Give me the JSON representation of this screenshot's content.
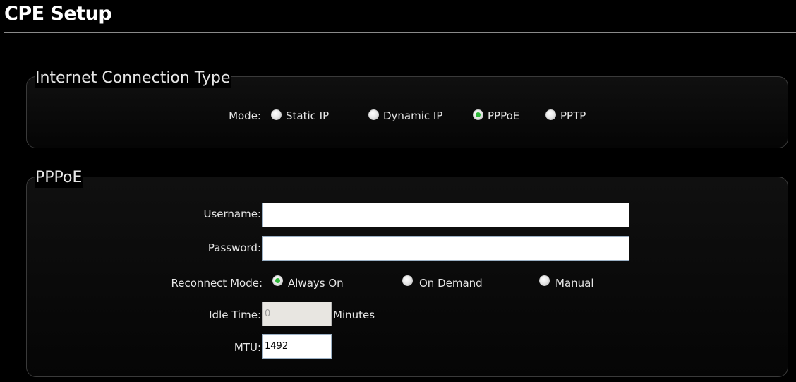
{
  "page": {
    "title": "CPE Setup"
  },
  "connection_type": {
    "legend": "Internet Connection Type",
    "mode_label": "Mode:",
    "options": [
      {
        "label": "Static IP",
        "checked": false
      },
      {
        "label": "Dynamic IP",
        "checked": false
      },
      {
        "label": "PPPoE",
        "checked": true
      },
      {
        "label": "PPTP",
        "checked": false
      }
    ]
  },
  "pppoe": {
    "legend": "PPPoE",
    "username_label": "Username:",
    "username_value": "",
    "password_label": "Password:",
    "password_value": "",
    "reconnect_label": "Reconnect Mode:",
    "reconnect_options": [
      {
        "label": "Always On",
        "checked": true
      },
      {
        "label": "On Demand",
        "checked": false
      },
      {
        "label": "Manual",
        "checked": false
      }
    ],
    "idle_label": "Idle Time:",
    "idle_value": "0",
    "idle_unit": "Minutes",
    "mtu_label": "MTU:",
    "mtu_value": "1492"
  }
}
